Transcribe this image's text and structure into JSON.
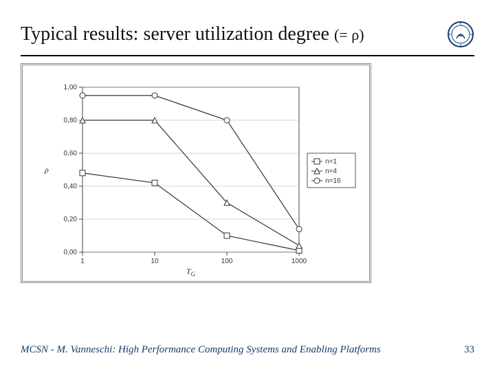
{
  "title": "Typical results: server utilization degree",
  "title_suffix": "(= ρ)",
  "seal_alt": "University of Pisa seal",
  "footer_credit": "MCSN  -   M. Vanneschi: High Performance Computing Systems and Enabling Platforms",
  "page_number": "33",
  "chart_data": {
    "type": "line",
    "x": [
      1,
      10,
      100,
      1000
    ],
    "xscale": "log",
    "categories_label": [
      "1",
      "10",
      "100",
      "1000"
    ],
    "series": [
      {
        "name": "n=1",
        "marker": "square",
        "values": [
          0.48,
          0.42,
          0.1,
          0.01
        ]
      },
      {
        "name": "n=4",
        "marker": "triangle",
        "values": [
          0.8,
          0.8,
          0.3,
          0.04
        ]
      },
      {
        "name": "n=16",
        "marker": "circle",
        "values": [
          0.95,
          0.95,
          0.8,
          0.14
        ]
      }
    ],
    "title": "",
    "xlabel": "T_G",
    "ylabel": "ρ",
    "xlim": [
      1,
      1000
    ],
    "ylim": [
      0.0,
      1.0
    ],
    "yticks": [
      0.0,
      0.2,
      0.4,
      0.6,
      0.8,
      1.0
    ],
    "ytick_labels": [
      "0,00",
      "0,20",
      "0,40",
      "0,60",
      "0,80",
      "1,00"
    ],
    "grid": false,
    "legend_pos": "right"
  }
}
